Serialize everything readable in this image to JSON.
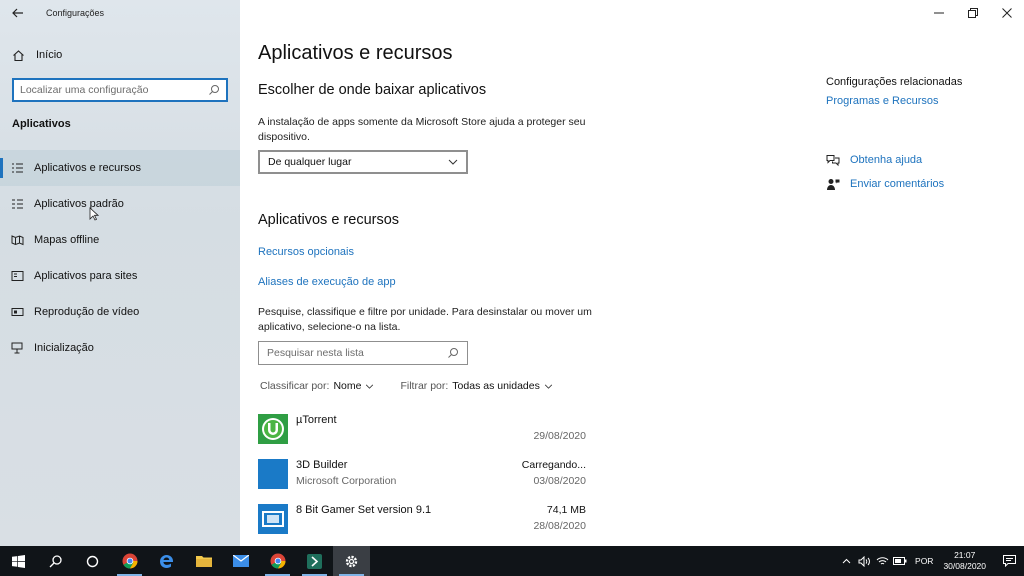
{
  "window": {
    "title": "Configurações",
    "minimize_icon": "minimize-icon",
    "maximize_icon": "restore-icon",
    "close_icon": "close-icon"
  },
  "sidebar": {
    "back_icon": "arrow-left-icon",
    "home_label": "Início",
    "search": {
      "placeholder": "Localizar uma configuração"
    },
    "section_title": "Aplicativos",
    "items": [
      {
        "label": "Aplicativos e recursos",
        "icon": "apps-list-icon",
        "active": true
      },
      {
        "label": "Aplicativos padrão",
        "icon": "default-apps-icon",
        "active": false
      },
      {
        "label": "Mapas offline",
        "icon": "map-icon",
        "active": false
      },
      {
        "label": "Aplicativos para sites",
        "icon": "web-apps-icon",
        "active": false
      },
      {
        "label": "Reprodução de vídeo",
        "icon": "video-icon",
        "active": false
      },
      {
        "label": "Inicialização",
        "icon": "startup-icon",
        "active": false
      }
    ]
  },
  "main": {
    "title": "Aplicativos e recursos",
    "install_section": {
      "heading": "Escolher de onde baixar aplicativos",
      "description": "A instalação de apps somente da Microsoft Store ajuda a proteger seu dispositivo.",
      "dropdown_value": "De qualquer lugar"
    },
    "apps_section": {
      "heading": "Aplicativos e recursos",
      "link_optional": "Recursos opcionais",
      "link_aliases": "Aliases de execução de app",
      "description": "Pesquise, classifique e filtre por unidade. Para desinstalar ou mover um aplicativo, selecione-o na lista.",
      "search_placeholder": "Pesquisar nesta lista",
      "sort_label": "Classificar por:",
      "sort_value": "Nome",
      "filter_label": "Filtrar por:",
      "filter_value": "Todas as unidades"
    },
    "apps": [
      {
        "name": "µTorrent",
        "publisher": "",
        "size": "",
        "date": "29/08/2020",
        "icon": "utorrent-icon",
        "color": "#4bb543"
      },
      {
        "name": "3D Builder",
        "publisher": "Microsoft Corporation",
        "size": "Carregando...",
        "date": "03/08/2020",
        "icon": "3d-builder-icon",
        "color": "#1a7ac7"
      },
      {
        "name": "8 Bit Gamer Set version 9.1",
        "publisher": "",
        "size": "74,1 MB",
        "date": "28/08/2020",
        "icon": "8bit-gamer-icon",
        "color": "#1a7ac7"
      }
    ]
  },
  "related": {
    "title": "Configurações relacionadas",
    "link": "Programas e Recursos",
    "help_label": "Obtenha ajuda",
    "help_icon": "chat-help-icon",
    "feedback_label": "Enviar comentários",
    "feedback_icon": "feedback-icon"
  },
  "taskbar": {
    "icons": [
      "windows-start-icon",
      "search-icon",
      "cortana-icon",
      "chrome-icon",
      "edge-icon",
      "file-explorer-icon",
      "mail-icon",
      "chrome-icon",
      "app-icon",
      "settings-icon"
    ],
    "tray": {
      "language": "POR",
      "time": "21:07",
      "date": "30/08/2020"
    }
  },
  "colors": {
    "accent": "#1e73be",
    "sidebar": "#dbe2e8",
    "taskbar": "#101418"
  }
}
